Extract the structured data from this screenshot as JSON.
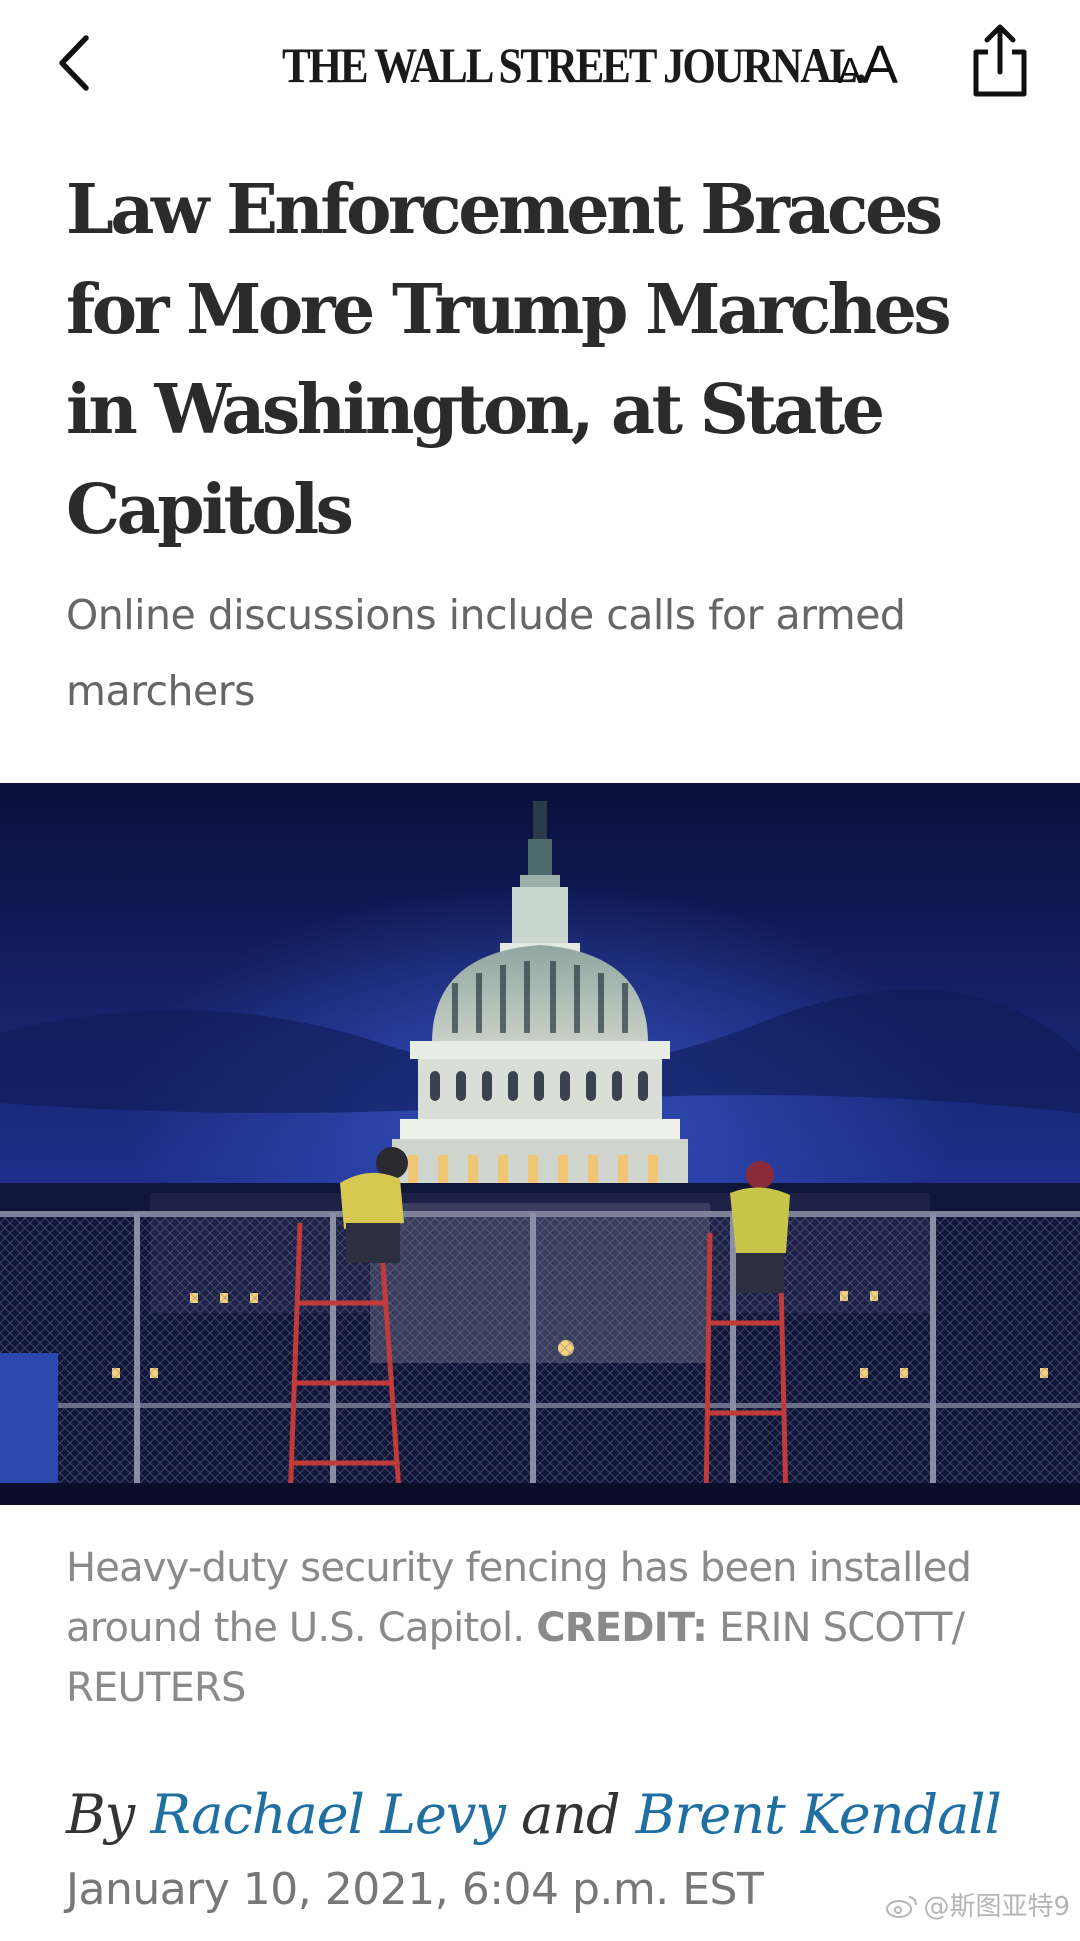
{
  "header": {
    "masthead": "THE WALL STREET JOURNAL.",
    "back_icon": "chevron-left-icon",
    "text_size_small": "A",
    "text_size_large": "A",
    "share_icon": "share-icon"
  },
  "article": {
    "headline": "Law Enforcement Braces for More Trump Marches in Washington, at State Capitols",
    "dek": "Online discussions include calls for armed marchers",
    "image_caption": "Heavy-duty security fencing has been installed around the U.S. Capitol.",
    "credit_label": "CREDIT:",
    "credit_value": "ERIN SCOTT/ REUTERS",
    "byline_prefix": "By",
    "author_1": "Rachael Levy",
    "byline_joiner": "and",
    "author_2": "Brent Kendall",
    "timestamp": "January 10, 2021, 6:04 p.m. EST"
  },
  "watermark": {
    "text": "@斯图亚特9",
    "icon": "weibo-icon"
  },
  "colors": {
    "author_link": "#1f6fa3",
    "headline": "#2b2b2b",
    "muted_text": "#8a8a8a",
    "night_sky": "#0a1240"
  }
}
